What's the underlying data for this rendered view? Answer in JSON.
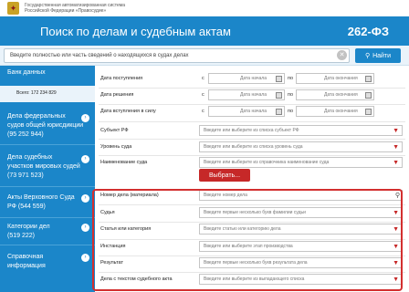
{
  "header": {
    "org_line1": "Государственная автоматизированная система",
    "org_line2": "Российской Федерации «Правосудие»",
    "title": "Поиск по делам и судебным актам",
    "law": "262-ФЗ"
  },
  "search": {
    "placeholder": "Введите полностью или часть сведений о находящихся в судах делах",
    "button": "Найти"
  },
  "sidebar": {
    "db_label": "Банк данных",
    "total": "Всего: 172 234 829",
    "items": [
      {
        "label_line1": "Дела федеральных",
        "label_line2": "судов общей юрисдикции",
        "label_line3": "(95 252 944)"
      },
      {
        "label_line1": "Дела судебных",
        "label_line2": "участков мировых судей",
        "label_line3": "(73 971 523)"
      },
      {
        "label_line1": "Акты Верховного Суда",
        "label_line2": "РФ (544 559)"
      },
      {
        "label_line1": "Категории дел",
        "label_line2": "(519 222)"
      },
      {
        "label_line1": "Справочная",
        "label_line2": "информация"
      }
    ]
  },
  "form": {
    "date_from_label": "с",
    "date_to_label": "по",
    "date_start_placeholder": "Дата начала",
    "date_end_placeholder": "Дата окончания",
    "rows": {
      "receipt": "Дата поступления",
      "decision": "Дата решения",
      "effect": "Дата вступления в силу",
      "subject": "Субъект РФ",
      "court_level": "Уровень суда",
      "court_name": "Наименование суда",
      "case_number": "Номер дела (материала)",
      "judge": "Судья",
      "article": "Статья или категория",
      "instance": "Инстанция",
      "result": "Результат",
      "act_text": "Дела с текстом судебного акта"
    },
    "placeholders": {
      "subject": "Введите или выберите из списка субъект РФ",
      "court_level": "Введите или выберите из списка уровень суда",
      "court_name": "Введите или выберите из справочника наименование суда",
      "case_number": "Введите номер дела",
      "judge": "Введите первые несколько букв фамилии судьи",
      "article": "Введите статью или категорию дела",
      "instance": "Введите или выберите этап производства",
      "result": "Введите первые несколько букв результата дела",
      "act_text": "Введите или выберите из выпадающего списка"
    },
    "choose_button": "Выбрать..."
  },
  "colors": {
    "brand_blue": "#1b86c9",
    "accent_red": "#c62828",
    "highlight_red": "#d32f2f"
  }
}
